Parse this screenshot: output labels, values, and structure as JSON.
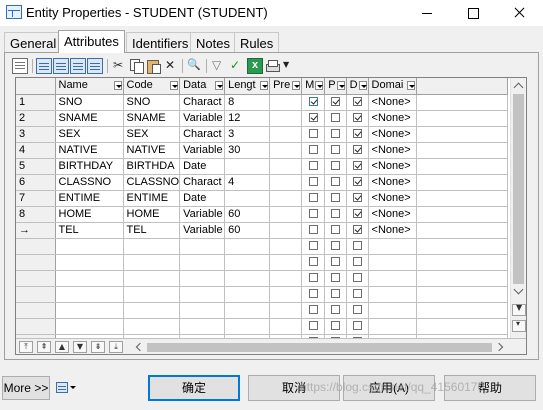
{
  "window": {
    "title": "Entity Properties - STUDENT (STUDENT)"
  },
  "tabs": [
    {
      "label": "General",
      "active": false
    },
    {
      "label": "Attributes",
      "active": true
    },
    {
      "label": "Identifiers",
      "active": false
    },
    {
      "label": "Notes",
      "active": false
    },
    {
      "label": "Rules",
      "active": false
    }
  ],
  "toolbar": {
    "icons": [
      "properties-icon",
      "add-row-icon",
      "insert-row-icon",
      "add-attribute-icon",
      "add-from-domain-icon",
      "cut-icon",
      "copy-icon",
      "paste-icon",
      "delete-icon",
      "find-icon",
      "filter-icon",
      "check-icon",
      "excel-export-icon",
      "print-icon",
      "dropdown-icon"
    ]
  },
  "grid": {
    "columns": [
      "Name",
      "Code",
      "Data",
      "Lengt",
      "Pre",
      "M",
      "P",
      "D",
      "Domai"
    ],
    "rows": [
      {
        "num": "1",
        "name": "SNO",
        "code": "SNO",
        "data": "Charact",
        "length": "8",
        "pre": "",
        "m": true,
        "p": true,
        "d": true,
        "domain": "<None>"
      },
      {
        "num": "2",
        "name": "SNAME",
        "code": "SNAME",
        "data": "Variable",
        "length": "12",
        "pre": "",
        "m": true,
        "p": false,
        "d": true,
        "domain": "<None>"
      },
      {
        "num": "3",
        "name": "SEX",
        "code": "SEX",
        "data": "Charact",
        "length": "3",
        "pre": "",
        "m": false,
        "p": false,
        "d": true,
        "domain": "<None>"
      },
      {
        "num": "4",
        "name": "NATIVE",
        "code": "NATIVE",
        "data": "Variable",
        "length": "30",
        "pre": "",
        "m": false,
        "p": false,
        "d": true,
        "domain": "<None>"
      },
      {
        "num": "5",
        "name": "BIRTHDAY",
        "code": "BIRTHDA",
        "data": "Date",
        "length": "",
        "pre": "",
        "m": false,
        "p": false,
        "d": true,
        "domain": "<None>"
      },
      {
        "num": "6",
        "name": "CLASSNO",
        "code": "CLASSNO",
        "data": "Charact",
        "length": "4",
        "pre": "",
        "m": false,
        "p": false,
        "d": true,
        "domain": "<None>"
      },
      {
        "num": "7",
        "name": "ENTIME",
        "code": "ENTIME",
        "data": "Date",
        "length": "",
        "pre": "",
        "m": false,
        "p": false,
        "d": true,
        "domain": "<None>"
      },
      {
        "num": "8",
        "name": "HOME",
        "code": "HOME",
        "data": "Variable",
        "length": "60",
        "pre": "",
        "m": false,
        "p": false,
        "d": true,
        "domain": "<None>"
      },
      {
        "num": "→",
        "name": "TEL",
        "code": "TEL",
        "data": "Variable",
        "length": "60",
        "pre": "",
        "m": false,
        "p": false,
        "d": true,
        "domain": "<None>"
      }
    ],
    "empty_rows": 7,
    "row_nav": [
      "⤒",
      "⇞",
      "▲",
      "▼",
      "⇟",
      "⤓"
    ]
  },
  "buttons": {
    "more": "More >>",
    "ok": "确定",
    "cancel": "取消",
    "apply": "应用(A)",
    "help": "帮助"
  },
  "watermark": "https://blog.csdn.net/qq_41560170"
}
